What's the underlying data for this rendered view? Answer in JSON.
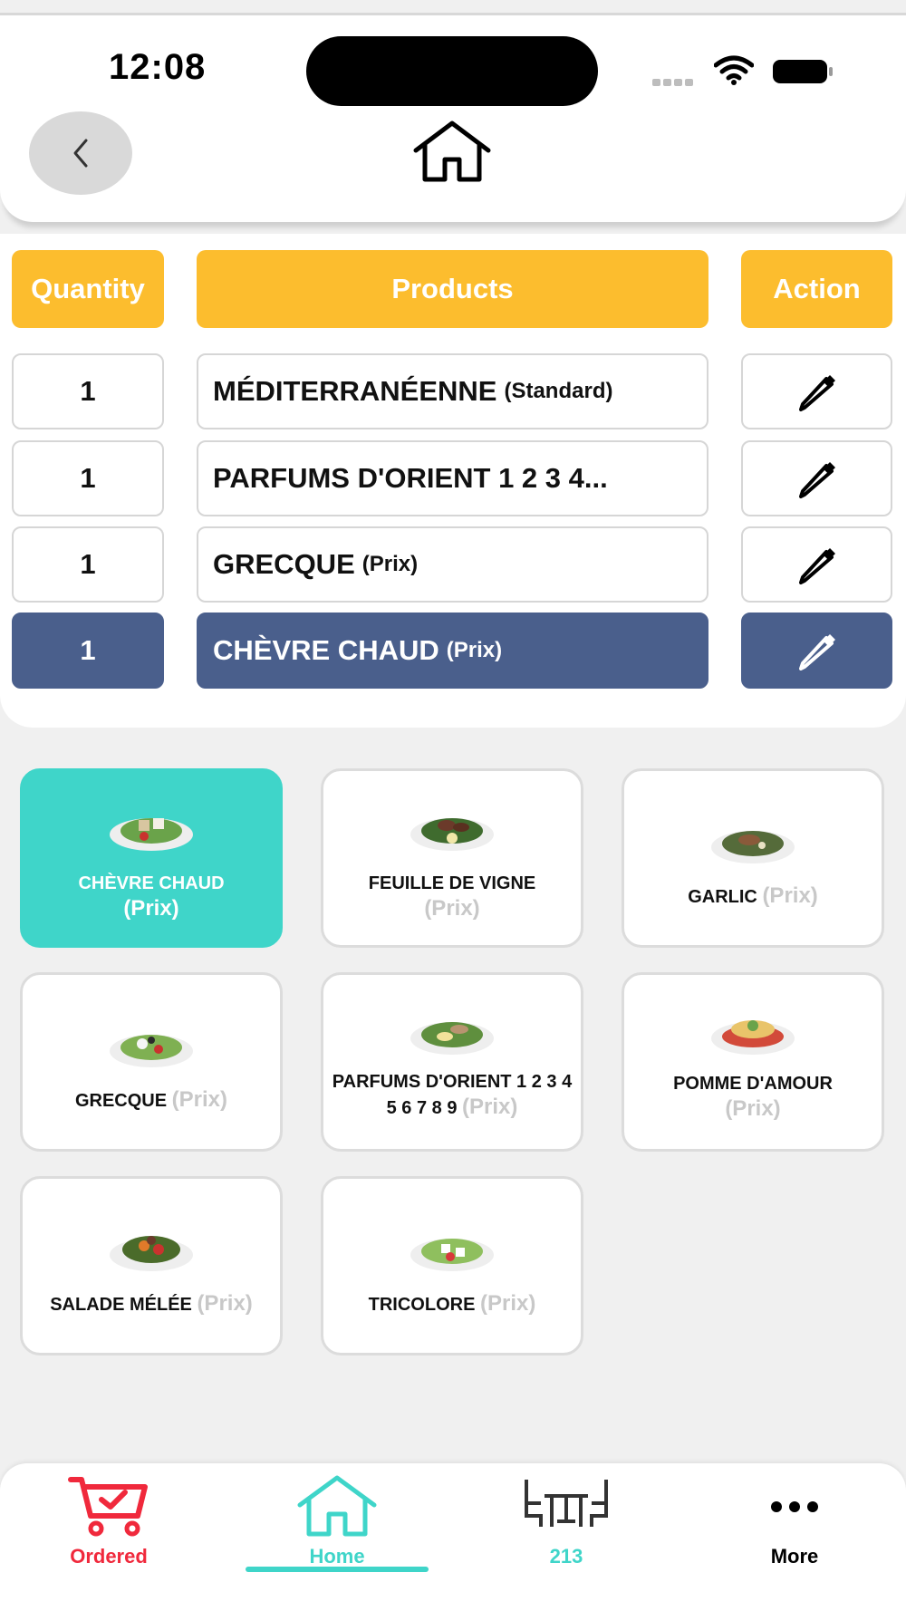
{
  "status_bar": {
    "time": "12:08"
  },
  "table": {
    "headers": {
      "quantity": "Quantity",
      "products": "Products",
      "action": "Action"
    },
    "rows": [
      {
        "qty": "1",
        "name": "MÉDITERRANÉENNE",
        "sub": "(Standard)",
        "selected": false
      },
      {
        "qty": "1",
        "name": "PARFUMS D'ORIENT 1 2 3 4...",
        "sub": "",
        "selected": false
      },
      {
        "qty": "1",
        "name": "GRECQUE",
        "sub": "(Prix)",
        "selected": false
      },
      {
        "qty": "1",
        "name": "CHÈVRE CHAUD",
        "sub": "(Prix)",
        "selected": true
      }
    ]
  },
  "products": [
    {
      "name": "CHÈVRE CHAUD",
      "price": "(Prix)",
      "active": true
    },
    {
      "name": "FEUILLE DE VIGNE",
      "price": "(Prix)",
      "active": false
    },
    {
      "name": "GARLIC",
      "price": "(Prix)",
      "active": false
    },
    {
      "name": "GRECQUE",
      "price": "(Prix)",
      "active": false
    },
    {
      "name": "PARFUMS D'ORIENT 1 2 3 4 5 6 7 8 9",
      "price": "(Prix)",
      "active": false
    },
    {
      "name": "POMME D'AMOUR",
      "price": "(Prix)",
      "active": false
    },
    {
      "name": "SALADE MÉLÉE",
      "price": "(Prix)",
      "active": false
    },
    {
      "name": "TRICOLORE",
      "price": "(Prix)",
      "active": false
    }
  ],
  "bottom_nav": {
    "ordered": "Ordered",
    "home": "Home",
    "tables": "213",
    "more": "More"
  },
  "colors": {
    "header_yellow": "#fcbd2e",
    "selected_row": "#4a5f8c",
    "accent_teal": "#3fd5c9",
    "ordered_red": "#f0293c"
  }
}
